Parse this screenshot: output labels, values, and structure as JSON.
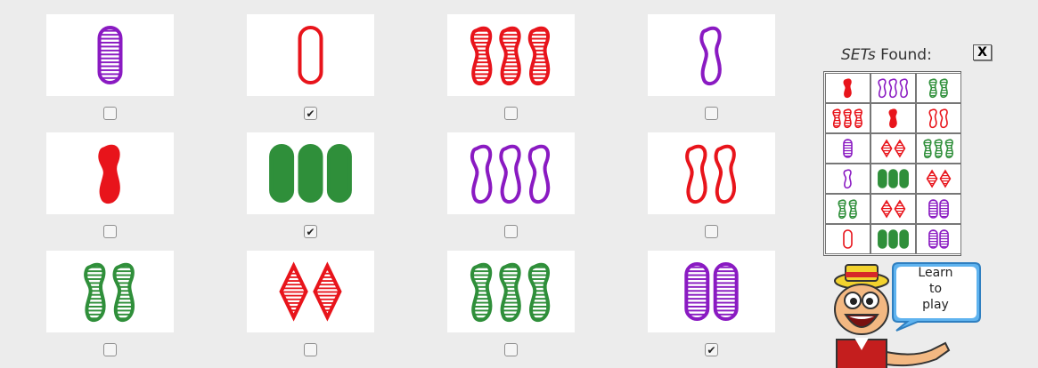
{
  "cards": [
    {
      "count": 1,
      "color": "purple",
      "shape": "oval",
      "shading": "striped",
      "selected": false
    },
    {
      "count": 1,
      "color": "red",
      "shape": "oval",
      "shading": "open",
      "selected": true
    },
    {
      "count": 3,
      "color": "red",
      "shape": "squiggle",
      "shading": "striped",
      "selected": false
    },
    {
      "count": 1,
      "color": "purple",
      "shape": "squiggle",
      "shading": "open",
      "selected": false
    },
    {
      "count": 1,
      "color": "red",
      "shape": "squiggle",
      "shading": "solid",
      "selected": false
    },
    {
      "count": 3,
      "color": "green",
      "shape": "oval",
      "shading": "solid",
      "selected": true
    },
    {
      "count": 3,
      "color": "purple",
      "shape": "squiggle",
      "shading": "open",
      "selected": false
    },
    {
      "count": 2,
      "color": "red",
      "shape": "squiggle",
      "shading": "open",
      "selected": false
    },
    {
      "count": 2,
      "color": "green",
      "shape": "squiggle",
      "shading": "striped",
      "selected": false
    },
    {
      "count": 2,
      "color": "red",
      "shape": "diamond",
      "shading": "striped",
      "selected": false
    },
    {
      "count": 3,
      "color": "green",
      "shape": "squiggle",
      "shading": "striped",
      "selected": false
    },
    {
      "count": 2,
      "color": "purple",
      "shape": "oval",
      "shading": "striped",
      "selected": true
    }
  ],
  "colors": {
    "red": "#e8141b",
    "green": "#2f8f3a",
    "purple": "#8a1ac2"
  },
  "sets_found": {
    "label_em": "SETs",
    "label_rest": " Found:",
    "close_label": "X",
    "rows": [
      [
        {
          "count": 1,
          "color": "red",
          "shape": "squiggle",
          "shading": "solid"
        },
        {
          "count": 3,
          "color": "purple",
          "shape": "squiggle",
          "shading": "open"
        },
        {
          "count": 2,
          "color": "green",
          "shape": "squiggle",
          "shading": "striped"
        }
      ],
      [
        {
          "count": 3,
          "color": "red",
          "shape": "squiggle",
          "shading": "striped"
        },
        {
          "count": 1,
          "color": "red",
          "shape": "squiggle",
          "shading": "solid"
        },
        {
          "count": 2,
          "color": "red",
          "shape": "squiggle",
          "shading": "open"
        }
      ],
      [
        {
          "count": 1,
          "color": "purple",
          "shape": "oval",
          "shading": "striped"
        },
        {
          "count": 2,
          "color": "red",
          "shape": "diamond",
          "shading": "striped"
        },
        {
          "count": 3,
          "color": "green",
          "shape": "squiggle",
          "shading": "striped"
        }
      ],
      [
        {
          "count": 1,
          "color": "purple",
          "shape": "squiggle",
          "shading": "open"
        },
        {
          "count": 3,
          "color": "green",
          "shape": "oval",
          "shading": "solid"
        },
        {
          "count": 2,
          "color": "red",
          "shape": "diamond",
          "shading": "striped"
        }
      ],
      [
        {
          "count": 2,
          "color": "green",
          "shape": "squiggle",
          "shading": "striped"
        },
        {
          "count": 2,
          "color": "red",
          "shape": "diamond",
          "shading": "striped"
        },
        {
          "count": 2,
          "color": "purple",
          "shape": "oval",
          "shading": "striped"
        }
      ],
      [
        {
          "count": 1,
          "color": "red",
          "shape": "oval",
          "shading": "open"
        },
        {
          "count": 3,
          "color": "green",
          "shape": "oval",
          "shading": "solid"
        },
        {
          "count": 2,
          "color": "purple",
          "shape": "oval",
          "shading": "striped"
        }
      ]
    ]
  },
  "learn": {
    "label": "Learn\nto\nplay"
  },
  "icons": {
    "checkbox_checked": "✔",
    "mascot": "mascot-icon"
  }
}
